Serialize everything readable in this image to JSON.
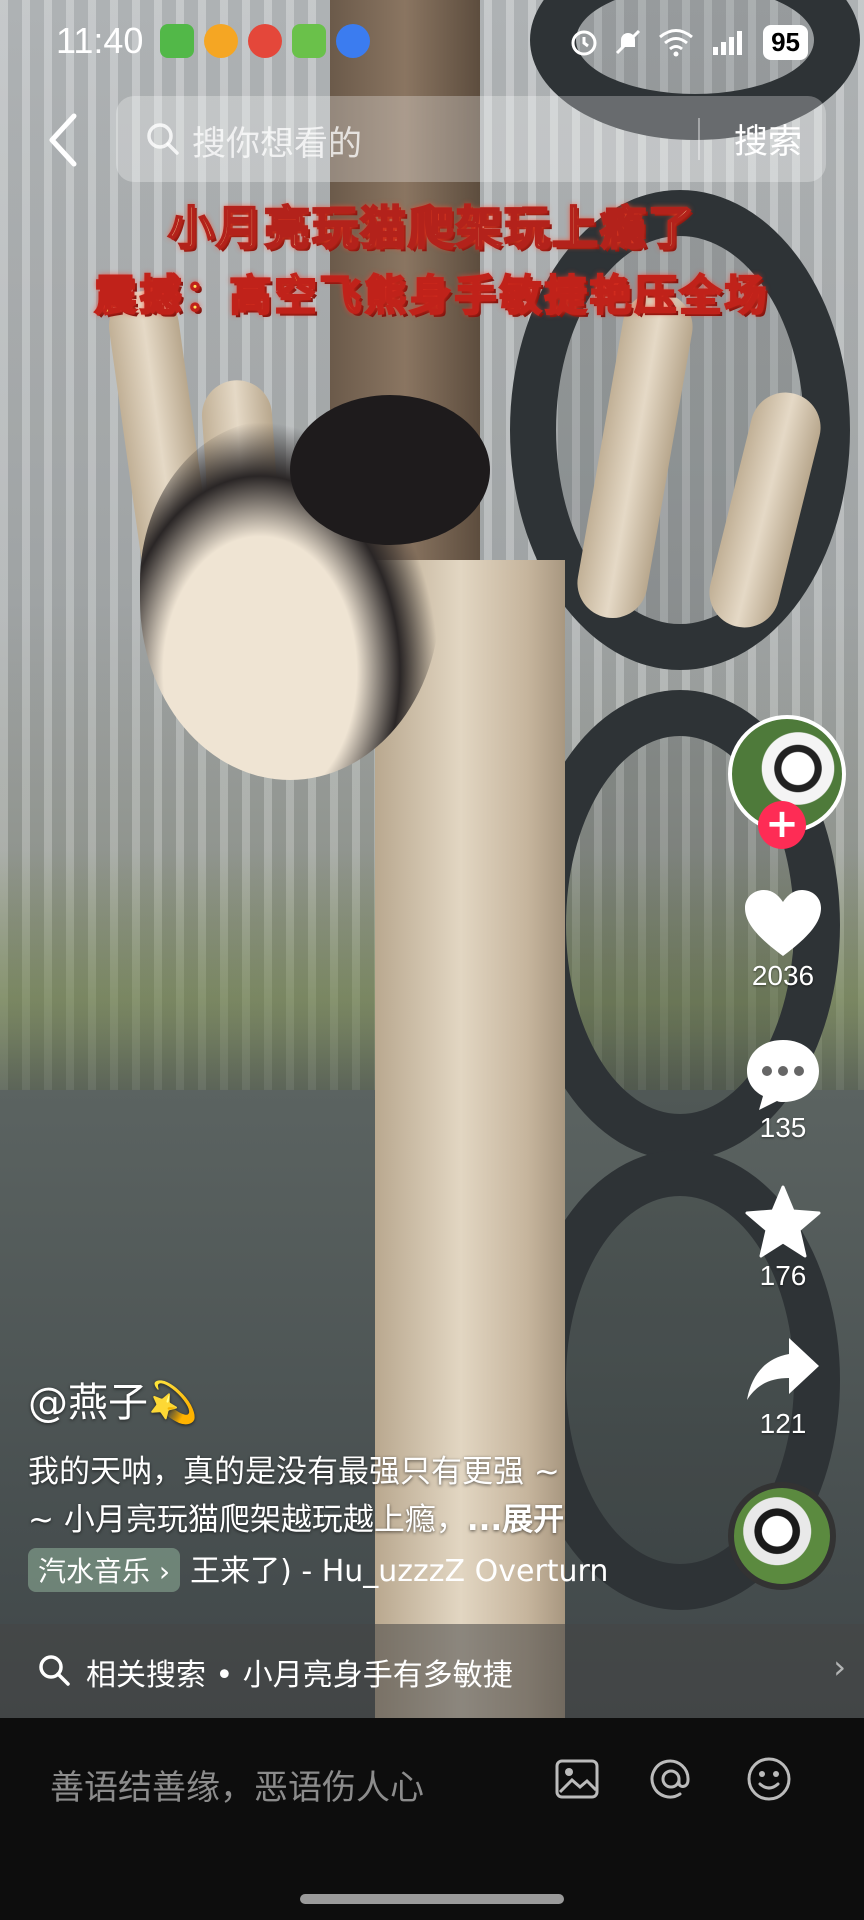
{
  "status_bar": {
    "time": "11:40",
    "battery": "95",
    "signal": "5A",
    "sim": "6"
  },
  "search": {
    "placeholder": "搜你想看的",
    "button": "搜索"
  },
  "video": {
    "caption_line1": "小月亮玩猫爬架玩上瘾了",
    "caption_line2": "震撼：高空飞熊身手敏捷艳压全场"
  },
  "actions": {
    "likes": "2036",
    "comments": "135",
    "favorites": "176",
    "shares": "121",
    "follow_symbol": "+"
  },
  "post": {
    "author": "@燕子💫",
    "description_line1": "我的天呐，真的是没有最强只有更强 ~",
    "description_line2": "~ 小月亮玩猫爬架越玩越上瘾，",
    "expand": "...展开",
    "music_tag": "汽水音乐 ›",
    "music_text": "王来了) - Hu_uzzzZ  Overturn"
  },
  "related": {
    "text": "相关搜索 • 小月亮身手有多敏捷",
    "chevron": "›"
  },
  "comment_bar": {
    "placeholder": "善语结善缘，恶语伤人心"
  },
  "colors": {
    "follow_red": "#fe2c55",
    "bottom_bar": "#0d0d0d"
  }
}
